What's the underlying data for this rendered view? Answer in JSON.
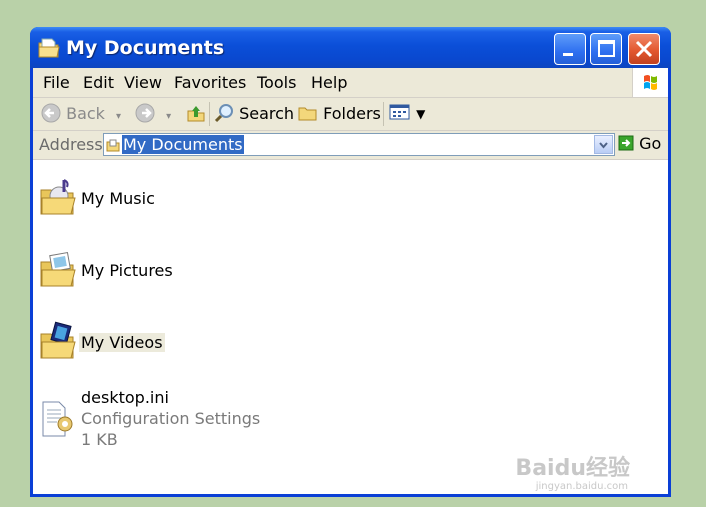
{
  "window": {
    "title": "My Documents"
  },
  "menubar": {
    "items": [
      "File",
      "Edit",
      "View",
      "Favorites",
      "Tools",
      "Help"
    ]
  },
  "toolbar": {
    "back_label": "Back",
    "search_label": "Search",
    "folders_label": "Folders"
  },
  "addressbar": {
    "label": "Address",
    "value": "My Documents",
    "go_label": "Go"
  },
  "files": [
    {
      "name": "My Music",
      "icon": "music-folder-icon"
    },
    {
      "name": "My Pictures",
      "icon": "pictures-folder-icon"
    },
    {
      "name": "My Videos",
      "icon": "videos-folder-icon"
    },
    {
      "name": "desktop.ini",
      "type": "Configuration Settings",
      "size": "1 KB",
      "icon": "config-file-icon"
    }
  ],
  "watermark": {
    "text": "Baidu经验",
    "sub": "jingyan.baidu.com"
  },
  "colors": {
    "titlebar": "#0a48cf",
    "selection": "#316ac5",
    "chrome": "#ece9d8",
    "desktop": "#b9d1a8"
  }
}
